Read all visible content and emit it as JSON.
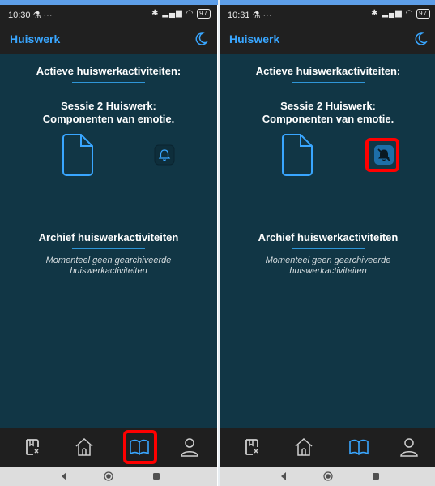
{
  "left": {
    "statusbar": {
      "time": "10:30",
      "extra": "⚗ ···",
      "battery": "97"
    },
    "appbar": {
      "title": "Huiswerk"
    },
    "active_title": "Actieve huiswerkactiviteiten:",
    "session_line1": "Sessie 2 Huiswerk:",
    "session_line2": "Componenten van emotie.",
    "archive_title": "Archief huiswerkactiviteiten",
    "archive_line1": "Momenteel geen gearchiveerde",
    "archive_line2": "huiswerkactiviteiten"
  },
  "right": {
    "statusbar": {
      "time": "10:31",
      "extra": "⚗ ···",
      "battery": "97"
    },
    "appbar": {
      "title": "Huiswerk"
    },
    "active_title": "Actieve huiswerkactiviteiten:",
    "session_line1": "Sessie 2 Huiswerk:",
    "session_line2": "Componenten van emotie.",
    "archive_title": "Archief huiswerkactiviteiten",
    "archive_line1": "Momenteel geen gearchiveerde",
    "archive_line2": "huiswerkactiviteiten"
  },
  "colors": {
    "background": "#113645",
    "accent": "#39a6ff",
    "highlight": "#ff0000",
    "bar": "#202020"
  },
  "icons": [
    "moon-icon",
    "document-icon",
    "bell-icon",
    "bell-off-icon",
    "notebook-icon",
    "home-icon",
    "book-icon",
    "profile-icon",
    "back-icon",
    "home-circle-icon",
    "recents-icon"
  ]
}
